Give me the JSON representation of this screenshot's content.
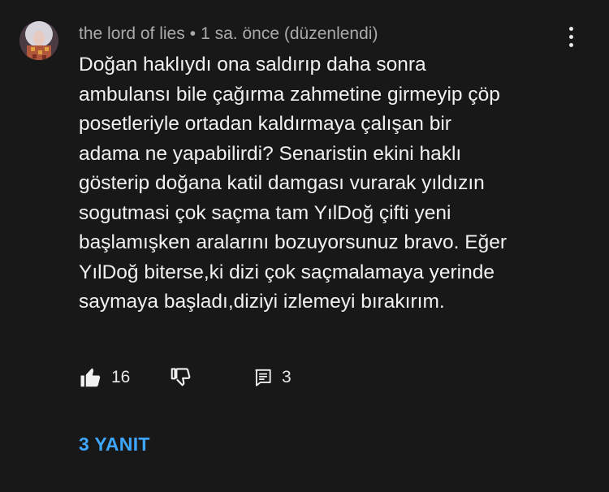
{
  "comment": {
    "author": "the lord of lies",
    "separator": "•",
    "time_ago": "1 sa. önce",
    "edited_label": "(düzenlendi)",
    "text": "Doğan haklıydı ona saldırıp daha sonra\nambulansı bile çağırma zahmetine girmeyip çöp\nposetleriyle ortadan kaldırmaya çalışan bir\nadama ne yapabilirdi? Senaristin ekini haklı\ngösterip doğana katil damgası vurarak yıldızın\nsogutmasi çok saçma tam YılDoğ çifti yeni\nbaşlamışken aralarını bozuyorsunuz bravo. Eğer\nYılDoğ biterse,ki dizi çok saçmalamaya yerinde\nsaymaya başladı,diziyi izlemeyi bırakırım.",
    "like_count": "16",
    "reply_count": "3",
    "replies_button": "3 YANIT"
  },
  "icons": {
    "avatar": "user-avatar",
    "menu": "kebab-menu-icon",
    "like": "thumbs-up-filled-icon",
    "dislike": "thumbs-down-outline-icon",
    "reply": "comment-icon"
  },
  "colors": {
    "background": "#181818",
    "text_primary": "#f1f1f1",
    "text_secondary": "#aaaaaa",
    "link_blue": "#3ea6ff"
  }
}
